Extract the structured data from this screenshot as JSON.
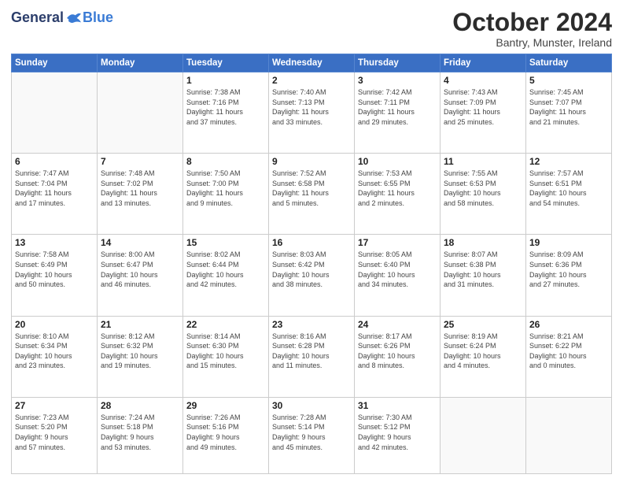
{
  "header": {
    "logo_general": "General",
    "logo_blue": "Blue",
    "month_title": "October 2024",
    "subtitle": "Bantry, Munster, Ireland"
  },
  "days_of_week": [
    "Sunday",
    "Monday",
    "Tuesday",
    "Wednesday",
    "Thursday",
    "Friday",
    "Saturday"
  ],
  "weeks": [
    [
      {
        "day": "",
        "info": ""
      },
      {
        "day": "",
        "info": ""
      },
      {
        "day": "1",
        "info": "Sunrise: 7:38 AM\nSunset: 7:16 PM\nDaylight: 11 hours\nand 37 minutes."
      },
      {
        "day": "2",
        "info": "Sunrise: 7:40 AM\nSunset: 7:13 PM\nDaylight: 11 hours\nand 33 minutes."
      },
      {
        "day": "3",
        "info": "Sunrise: 7:42 AM\nSunset: 7:11 PM\nDaylight: 11 hours\nand 29 minutes."
      },
      {
        "day": "4",
        "info": "Sunrise: 7:43 AM\nSunset: 7:09 PM\nDaylight: 11 hours\nand 25 minutes."
      },
      {
        "day": "5",
        "info": "Sunrise: 7:45 AM\nSunset: 7:07 PM\nDaylight: 11 hours\nand 21 minutes."
      }
    ],
    [
      {
        "day": "6",
        "info": "Sunrise: 7:47 AM\nSunset: 7:04 PM\nDaylight: 11 hours\nand 17 minutes."
      },
      {
        "day": "7",
        "info": "Sunrise: 7:48 AM\nSunset: 7:02 PM\nDaylight: 11 hours\nand 13 minutes."
      },
      {
        "day": "8",
        "info": "Sunrise: 7:50 AM\nSunset: 7:00 PM\nDaylight: 11 hours\nand 9 minutes."
      },
      {
        "day": "9",
        "info": "Sunrise: 7:52 AM\nSunset: 6:58 PM\nDaylight: 11 hours\nand 5 minutes."
      },
      {
        "day": "10",
        "info": "Sunrise: 7:53 AM\nSunset: 6:55 PM\nDaylight: 11 hours\nand 2 minutes."
      },
      {
        "day": "11",
        "info": "Sunrise: 7:55 AM\nSunset: 6:53 PM\nDaylight: 10 hours\nand 58 minutes."
      },
      {
        "day": "12",
        "info": "Sunrise: 7:57 AM\nSunset: 6:51 PM\nDaylight: 10 hours\nand 54 minutes."
      }
    ],
    [
      {
        "day": "13",
        "info": "Sunrise: 7:58 AM\nSunset: 6:49 PM\nDaylight: 10 hours\nand 50 minutes."
      },
      {
        "day": "14",
        "info": "Sunrise: 8:00 AM\nSunset: 6:47 PM\nDaylight: 10 hours\nand 46 minutes."
      },
      {
        "day": "15",
        "info": "Sunrise: 8:02 AM\nSunset: 6:44 PM\nDaylight: 10 hours\nand 42 minutes."
      },
      {
        "day": "16",
        "info": "Sunrise: 8:03 AM\nSunset: 6:42 PM\nDaylight: 10 hours\nand 38 minutes."
      },
      {
        "day": "17",
        "info": "Sunrise: 8:05 AM\nSunset: 6:40 PM\nDaylight: 10 hours\nand 34 minutes."
      },
      {
        "day": "18",
        "info": "Sunrise: 8:07 AM\nSunset: 6:38 PM\nDaylight: 10 hours\nand 31 minutes."
      },
      {
        "day": "19",
        "info": "Sunrise: 8:09 AM\nSunset: 6:36 PM\nDaylight: 10 hours\nand 27 minutes."
      }
    ],
    [
      {
        "day": "20",
        "info": "Sunrise: 8:10 AM\nSunset: 6:34 PM\nDaylight: 10 hours\nand 23 minutes."
      },
      {
        "day": "21",
        "info": "Sunrise: 8:12 AM\nSunset: 6:32 PM\nDaylight: 10 hours\nand 19 minutes."
      },
      {
        "day": "22",
        "info": "Sunrise: 8:14 AM\nSunset: 6:30 PM\nDaylight: 10 hours\nand 15 minutes."
      },
      {
        "day": "23",
        "info": "Sunrise: 8:16 AM\nSunset: 6:28 PM\nDaylight: 10 hours\nand 11 minutes."
      },
      {
        "day": "24",
        "info": "Sunrise: 8:17 AM\nSunset: 6:26 PM\nDaylight: 10 hours\nand 8 minutes."
      },
      {
        "day": "25",
        "info": "Sunrise: 8:19 AM\nSunset: 6:24 PM\nDaylight: 10 hours\nand 4 minutes."
      },
      {
        "day": "26",
        "info": "Sunrise: 8:21 AM\nSunset: 6:22 PM\nDaylight: 10 hours\nand 0 minutes."
      }
    ],
    [
      {
        "day": "27",
        "info": "Sunrise: 7:23 AM\nSunset: 5:20 PM\nDaylight: 9 hours\nand 57 minutes."
      },
      {
        "day": "28",
        "info": "Sunrise: 7:24 AM\nSunset: 5:18 PM\nDaylight: 9 hours\nand 53 minutes."
      },
      {
        "day": "29",
        "info": "Sunrise: 7:26 AM\nSunset: 5:16 PM\nDaylight: 9 hours\nand 49 minutes."
      },
      {
        "day": "30",
        "info": "Sunrise: 7:28 AM\nSunset: 5:14 PM\nDaylight: 9 hours\nand 45 minutes."
      },
      {
        "day": "31",
        "info": "Sunrise: 7:30 AM\nSunset: 5:12 PM\nDaylight: 9 hours\nand 42 minutes."
      },
      {
        "day": "",
        "info": ""
      },
      {
        "day": "",
        "info": ""
      }
    ]
  ]
}
